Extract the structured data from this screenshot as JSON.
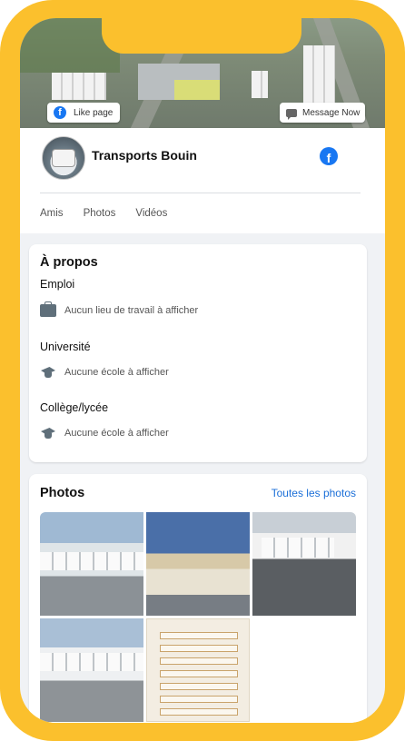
{
  "cover": {
    "like_label": "Like page",
    "message_label": "Message Now"
  },
  "profile": {
    "name": "Transports Bouin",
    "tabs": [
      "Amis",
      "Photos",
      "Vidéos"
    ]
  },
  "about": {
    "title": "À propos",
    "sections": [
      {
        "label": "Emploi",
        "text": "Aucun lieu de travail à afficher",
        "icon": "briefcase-icon"
      },
      {
        "label": "Université",
        "text": "Aucune école à afficher",
        "icon": "graduation-cap-icon"
      },
      {
        "label": "Collège/lycée",
        "text": "Aucune école à afficher",
        "icon": "graduation-cap-icon"
      }
    ]
  },
  "photos": {
    "title": "Photos",
    "all_link": "Toutes les photos"
  },
  "colors": {
    "frame": "#fbc02d",
    "facebook_blue": "#1877f2",
    "link": "#1b6fd8"
  }
}
